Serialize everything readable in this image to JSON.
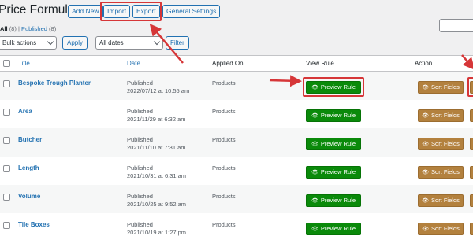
{
  "header": {
    "title": "Price Formula",
    "buttons": {
      "add_new": "Add New",
      "import": "Import",
      "export": "Export",
      "general_settings": "General Settings"
    }
  },
  "subsubsub": {
    "all_label": "All",
    "all_count": "(8)",
    "separator": "|",
    "published_label": "Published",
    "published_count": "(8)"
  },
  "filters": {
    "bulk_actions": "Bulk actions",
    "apply": "Apply",
    "dates": "All dates",
    "filter": "Filter"
  },
  "table": {
    "columns": {
      "title": "Title",
      "date": "Date",
      "applied_on": "Applied On",
      "view_rule": "View Rule",
      "action": "Action"
    },
    "preview_label": "Preview Rule",
    "sort_label": "Sort Fields",
    "rows": [
      {
        "title": "Bespoke Trough Planter",
        "status": "Published",
        "date": "2022/07/12 at 10:55 am",
        "applied": "Products"
      },
      {
        "title": "Area",
        "status": "Published",
        "date": "2021/11/29 at 6:32 am",
        "applied": "Products"
      },
      {
        "title": "Butcher",
        "status": "Published",
        "date": "2021/11/10 at 7:31 am",
        "applied": "Products"
      },
      {
        "title": "Length",
        "status": "Published",
        "date": "2021/10/31 at 6:31 am",
        "applied": "Products"
      },
      {
        "title": "Volume",
        "status": "Published",
        "date": "2021/10/25 at 9:52 am",
        "applied": "Products"
      },
      {
        "title": "Tile Boxes",
        "status": "Published",
        "date": "2021/10/19 at 1:27 pm",
        "applied": "Products"
      }
    ]
  },
  "colors": {
    "accent": "#2271b1",
    "preview_green": "#0a8a0a",
    "sort_brown": "#b3813e",
    "annotation_red": "#d63638"
  },
  "icons": {
    "preview": "eye-icon",
    "sort": "sort-icon"
  }
}
